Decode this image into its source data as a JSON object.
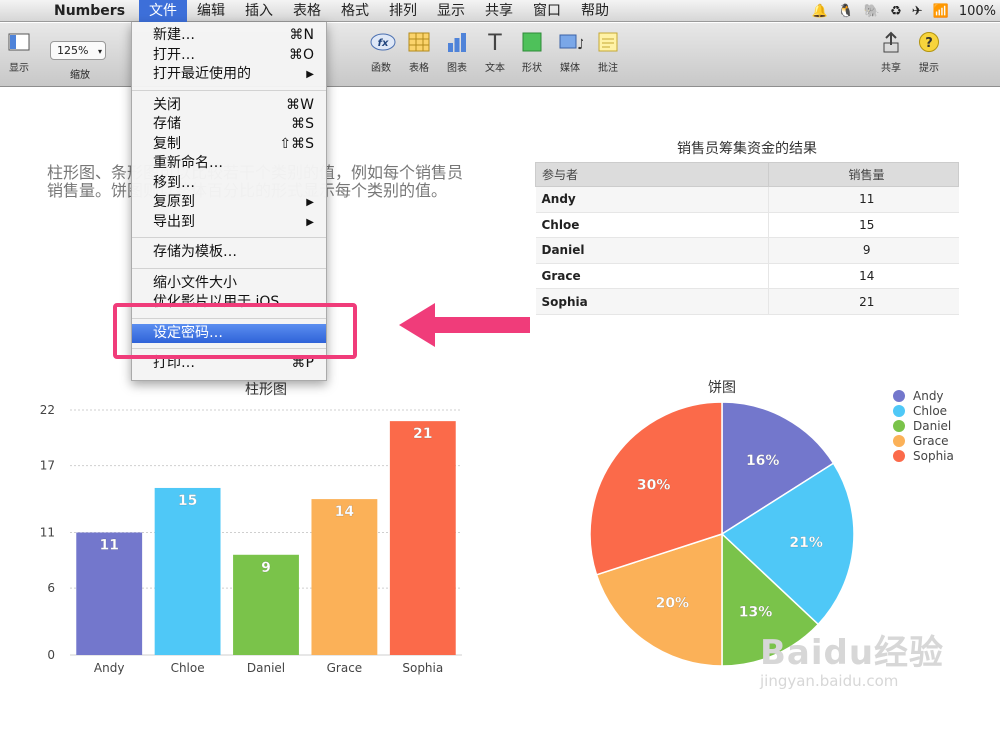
{
  "menubar": {
    "app_name": "Numbers",
    "items": [
      "文件",
      "编辑",
      "插入",
      "表格",
      "格式",
      "排列",
      "显示",
      "共享",
      "窗口",
      "帮助"
    ],
    "battery": "100%"
  },
  "toolbar": {
    "view_label": "显示",
    "zoom_value": "125%",
    "zoom_label": "缩放",
    "function_label": "函数",
    "table_label": "表格",
    "chart_label": "图表",
    "text_label": "文本",
    "shape_label": "形状",
    "media_label": "媒体",
    "comment_label": "批注",
    "share_label": "共享",
    "tips_label": "提示"
  },
  "file_menu": {
    "new": {
      "label": "新建…",
      "shortcut": "⌘N"
    },
    "open": {
      "label": "打开…",
      "shortcut": "⌘O"
    },
    "open_recent": {
      "label": "打开最近使用的"
    },
    "close": {
      "label": "关闭",
      "shortcut": "⌘W"
    },
    "save": {
      "label": "存储",
      "shortcut": "⌘S"
    },
    "duplicate": {
      "label": "复制",
      "shortcut": "⇧⌘S"
    },
    "rename": {
      "label": "重新命名…"
    },
    "move_to": {
      "label": "移到…"
    },
    "revert_to": {
      "label": "复原到"
    },
    "export_to": {
      "label": "导出到"
    },
    "save_as_template": {
      "label": "存储为模板…"
    },
    "reduce_size": {
      "label": "缩小文件大小"
    },
    "optimize_ios": {
      "label": "优化影片以用于 iOS"
    },
    "set_password": {
      "label": "设定密码…"
    },
    "print": {
      "label": "打印…",
      "shortcut": "⌘P"
    }
  },
  "canvas": {
    "body_text": "柱形图、条形图可以比较若干个类别的值，例如每个销售员销售量。饼图则以整体百分比的形式显示每个类别的值。"
  },
  "table": {
    "title": "销售员筹集资金的结果",
    "headers": [
      "参与者",
      "销售量"
    ],
    "rows": [
      [
        "Andy",
        "11"
      ],
      [
        "Chloe",
        "15"
      ],
      [
        "Daniel",
        "9"
      ],
      [
        "Grace",
        "14"
      ],
      [
        "Sophia",
        "21"
      ]
    ]
  },
  "watermark": {
    "brand": "Baidu经验",
    "url": "jingyan.baidu.com"
  },
  "chart_data": [
    {
      "type": "bar",
      "title": "柱形图",
      "categories": [
        "Andy",
        "Chloe",
        "Daniel",
        "Grace",
        "Sophia"
      ],
      "values": [
        11,
        15,
        9,
        14,
        21
      ],
      "ylim": [
        0,
        22
      ],
      "yticks": [
        0,
        6,
        11,
        17,
        22
      ],
      "grid": true,
      "colors": [
        "#7377cc",
        "#4fc8f7",
        "#7ac34a",
        "#fbb158",
        "#fb6a4a"
      ]
    },
    {
      "type": "pie",
      "title": "饼图",
      "labels": [
        "Andy",
        "Chloe",
        "Daniel",
        "Grace",
        "Sophia"
      ],
      "values": [
        16,
        21,
        13,
        20,
        30
      ],
      "value_labels": [
        "16%",
        "21%",
        "13%",
        "20%",
        "30%"
      ],
      "legend": "top-right",
      "colors": [
        "#7377cc",
        "#4fc8f7",
        "#7ac34a",
        "#fbb158",
        "#fb6a4a"
      ]
    }
  ]
}
